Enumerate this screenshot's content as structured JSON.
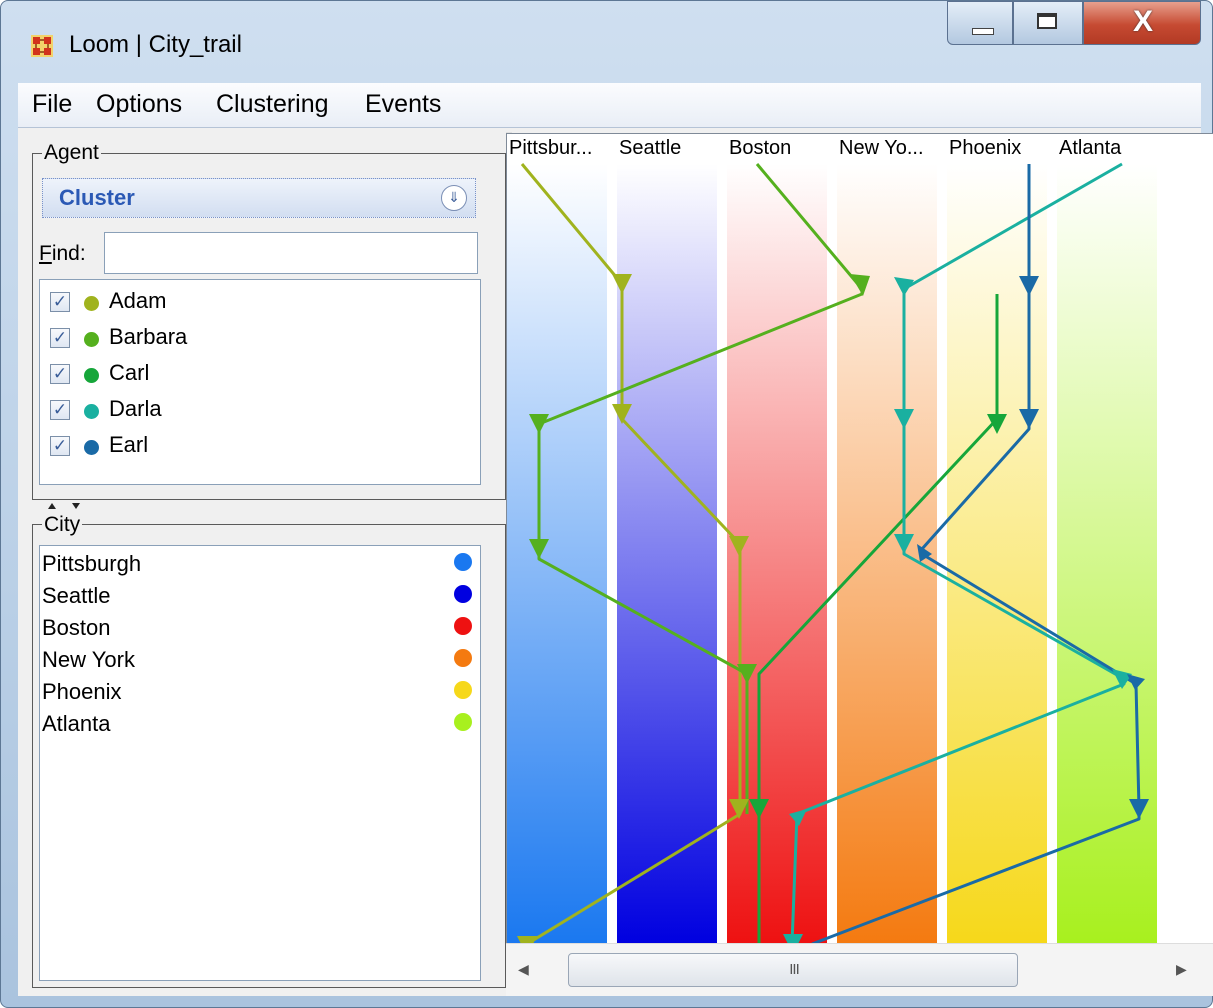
{
  "window": {
    "title": "Loom | City_trail",
    "close_glyph": "X"
  },
  "menu": [
    "File",
    "Options",
    "Clustering",
    "Events"
  ],
  "agent_panel": {
    "title": "Agent",
    "cluster_value": "Cluster",
    "find_label": "Find:",
    "find_value": "",
    "agents": [
      {
        "name": "Adam",
        "checked": true,
        "color": "#a0b31e"
      },
      {
        "name": "Barbara",
        "checked": true,
        "color": "#55b01e"
      },
      {
        "name": "Carl",
        "checked": true,
        "color": "#16a63a"
      },
      {
        "name": "Darla",
        "checked": true,
        "color": "#1ab0a0"
      },
      {
        "name": "Earl",
        "checked": true,
        "color": "#1a6aa6"
      }
    ]
  },
  "city_panel": {
    "title": "City",
    "cities": [
      {
        "name": "Pittsburgh",
        "color": "#1a78f0"
      },
      {
        "name": "Seattle",
        "color": "#0000e0"
      },
      {
        "name": "Boston",
        "color": "#ee1111"
      },
      {
        "name": "New York",
        "color": "#f47a10"
      },
      {
        "name": "Phoenix",
        "color": "#f6d81a"
      },
      {
        "name": "Atlanta",
        "color": "#a8f01e"
      }
    ]
  },
  "chart": {
    "column_labels": [
      "Pittsbur...",
      "Seattle",
      "Boston",
      "New Yo...",
      "Phoenix",
      "Atlanta"
    ],
    "scrollbar_grip": "III"
  },
  "icons": {
    "app": "network-grid-icon",
    "combo": "double-chevron-down-icon",
    "splitter": "splitter-arrows-icon",
    "scroll_left": "scroll-left-arrow-icon",
    "scroll_right": "scroll-right-arrow-icon"
  }
}
